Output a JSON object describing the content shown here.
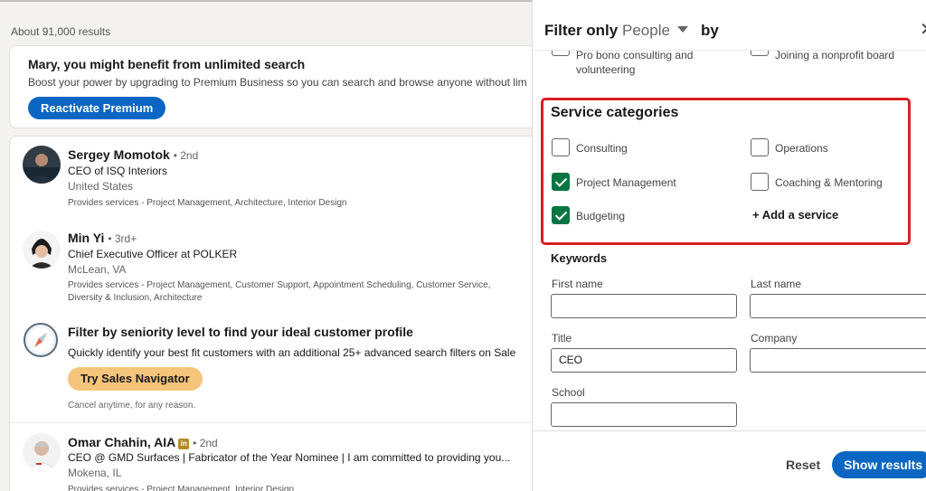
{
  "results": {
    "count_text": "About 91,000 results"
  },
  "premium": {
    "title": "Mary, you might benefit from unlimited search",
    "subtitle": "Boost your power by upgrading to Premium Business so you can search and browse anyone without lim",
    "button_label": "Reactivate Premium"
  },
  "people": [
    {
      "name": "Sergey Momotok",
      "degree": "• 2nd",
      "title": "CEO of ISQ Interiors",
      "location": "United States",
      "services": "Provides services - Project Management, Architecture, Interior Design"
    },
    {
      "name": "Min Yi",
      "degree": "• 3rd+",
      "title": "Chief Executive Officer at POLKER",
      "location": "McLean, VA",
      "services": "Provides services - Project Management, Customer Support, Appointment Scheduling, Customer Service, Diversity & Inclusion, Architecture"
    },
    {
      "name": "Omar Chahin, AIA",
      "degree": "• 2nd",
      "title": "CEO @ GMD Surfaces | Fabricator of the Year Nominee | I am committed to providing you...",
      "location": "Mokena, IL",
      "services": "Provides services - Project Management, Interior Design"
    }
  ],
  "sales_nav": {
    "title": "Filter by seniority level to find your ideal customer profile",
    "subtitle": "Quickly identify your best fit customers with an additional 25+ advanced search filters on Sale",
    "button_label": "Try Sales Navigator",
    "cancel_text": "Cancel anytime, for any reason.",
    "icon": "compass-icon"
  },
  "filter_panel": {
    "header_prefix": "Filter only",
    "entity": "People",
    "header_suffix": "by",
    "close_icon": "✕",
    "partial_row": {
      "left": "Pro bono consulting and",
      "left_line2": "volunteering",
      "right": "Joining a nonprofit board"
    },
    "service_categories": {
      "title": "Service categories",
      "options": [
        {
          "label": "Consulting",
          "checked": false
        },
        {
          "label": "Operations",
          "checked": false
        },
        {
          "label": "Project Management",
          "checked": true
        },
        {
          "label": "Coaching & Mentoring",
          "checked": false
        },
        {
          "label": "Budgeting",
          "checked": true
        }
      ],
      "add_label": "+ Add a service"
    },
    "keywords": {
      "title": "Keywords",
      "first_name": {
        "label": "First name",
        "value": ""
      },
      "last_name": {
        "label": "Last name",
        "value": ""
      },
      "title_field": {
        "label": "Title",
        "value": "CEO"
      },
      "company": {
        "label": "Company",
        "value": ""
      },
      "school": {
        "label": "School",
        "value": ""
      }
    },
    "footer": {
      "reset_label": "Reset",
      "show_label": "Show results"
    }
  },
  "colors": {
    "linkedin_blue": "#0a66c2",
    "check_green": "#057642",
    "highlight_red": "#d81f26",
    "sales_nav_gold": "#f5c57b"
  }
}
